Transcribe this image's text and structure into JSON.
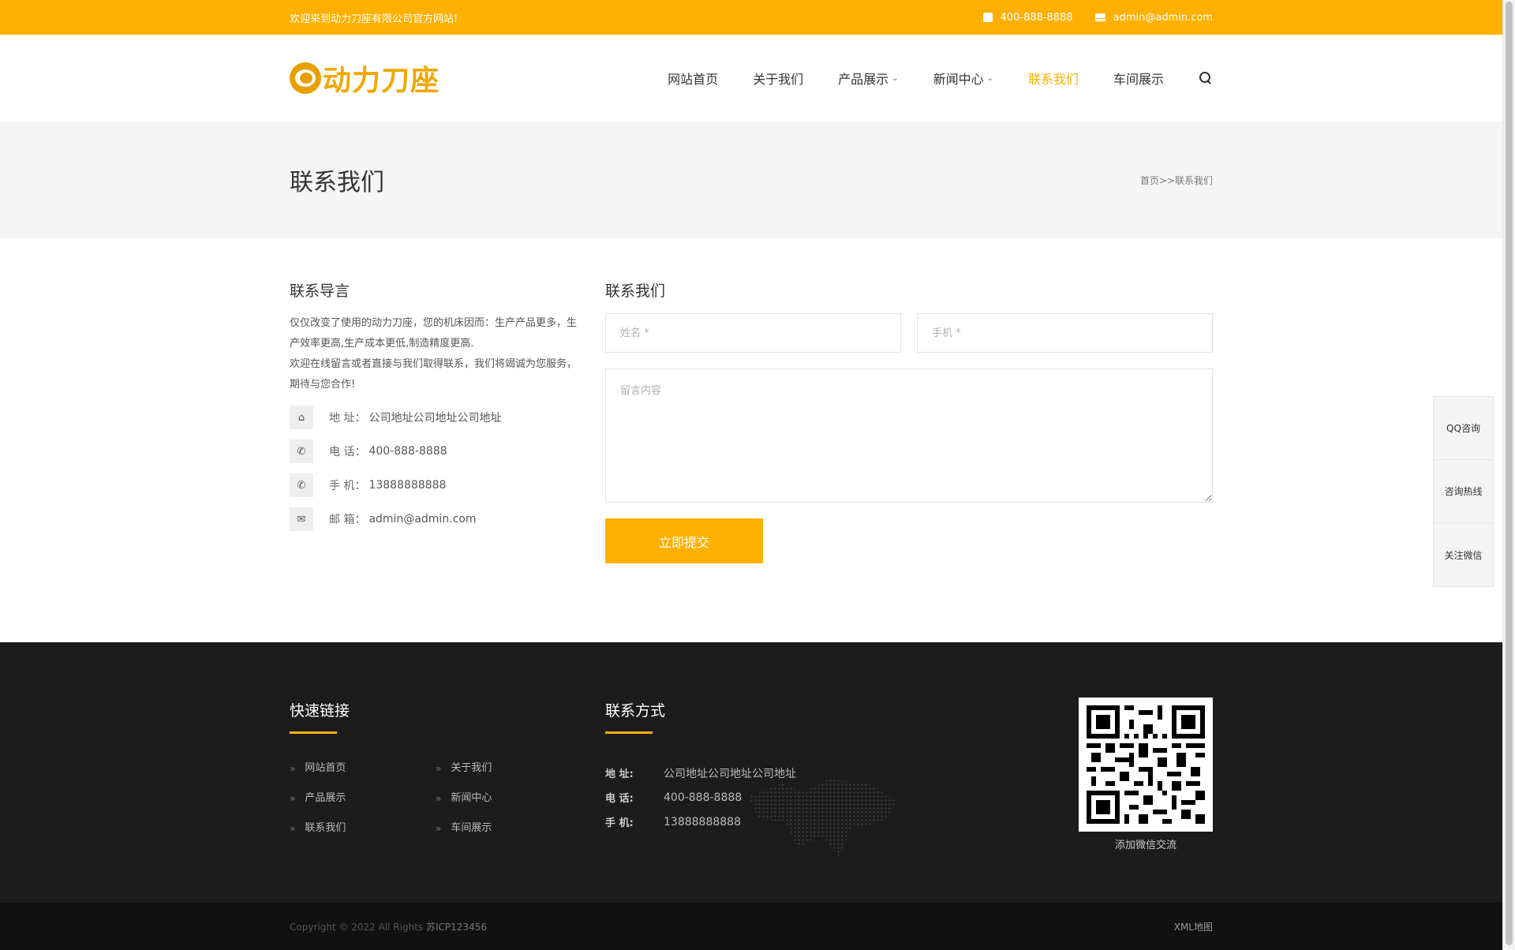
{
  "topbar": {
    "welcome": "欢迎来到动力刀座有限公司官方网站!",
    "phone": "400-888-8888",
    "email": "admin@admin.com"
  },
  "header": {
    "logo_text": "动力刀座",
    "nav": [
      {
        "label": "网站首页"
      },
      {
        "label": "关于我们"
      },
      {
        "label": "产品展示",
        "dropdown": true
      },
      {
        "label": "新闻中心",
        "dropdown": true
      },
      {
        "label": "联系我们",
        "active": true
      },
      {
        "label": "车间展示"
      }
    ]
  },
  "banner": {
    "title": "联系我们",
    "breadcrumb": "首页>>联系我们"
  },
  "guide": {
    "title": "联系导言",
    "intro1": "仅仅改变了使用的动力刀座，您的机床因而：生产产品更多，生产效率更高,生产成本更低,制造精度更高.",
    "intro2": "欢迎在线留言或者直接与我们取得联系，我们将竭诚为您服务，期待与您合作!",
    "address_label": "地 址：",
    "address": "公司地址公司地址公司地址",
    "tel_label": "电 话：",
    "tel": "400-888-8888",
    "mobile_label": "手 机：",
    "mobile": "13888888888",
    "email_label": "邮 箱：",
    "email": "admin@admin.com"
  },
  "form": {
    "title": "联系我们",
    "name_placeholder": "姓名 *",
    "phone_placeholder": "手机 *",
    "message_placeholder": "留言内容",
    "submit_label": "立即提交"
  },
  "sidefloat": [
    "QQ咨询",
    "咨询热线",
    "关注微信"
  ],
  "footer": {
    "links_title": "快速链接",
    "links": [
      "网站首页",
      "关于我们",
      "产品展示",
      "新闻中心",
      "联系我们",
      "车间展示"
    ],
    "contact_title": "联系方式",
    "address_label": "地 址:",
    "address": "公司地址公司地址公司地址",
    "tel_label": "电 话:",
    "tel": "400-888-8888",
    "mobile_label": "手 机:",
    "mobile": "13888888888",
    "qr_caption": "添加微信交流",
    "copyright": "Copyright © 2022 All Rights",
    "icp": "苏ICP123456",
    "sitemap": "XML地图"
  },
  "colors": {
    "accent": "#ffb000",
    "footer_bg": "#1c1c1c",
    "banner_bg": "#f5f5f5"
  }
}
